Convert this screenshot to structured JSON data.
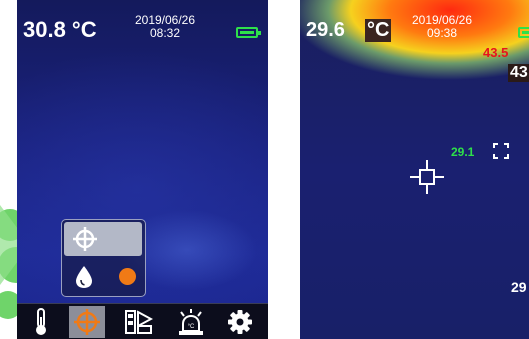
{
  "colors": {
    "accent_orange": "#f07a16",
    "battery_green": "#2ee04a",
    "hot_red": "#e8141c",
    "spot_green": "#2ee04a"
  },
  "left_screen": {
    "center_temp": "30.8 °C",
    "date": "2019/06/26",
    "time": "08:32",
    "battery_icon": "battery-full-icon",
    "mode_menu": {
      "selected_icon": "crosshair-icon",
      "second_icon": "water-drop-icon",
      "color_dot": "#f07a16"
    },
    "toolbar": [
      {
        "icon": "thermometer-icon"
      },
      {
        "icon": "crosshair-icon",
        "active": true
      },
      {
        "icon": "palette-icon"
      },
      {
        "icon": "alarm-icon"
      },
      {
        "icon": "gear-icon"
      }
    ]
  },
  "right_screen": {
    "center_temp": "29.6",
    "unit": "°C",
    "date": "2019/06/26",
    "time": "09:38",
    "max_value": "43.5",
    "max_value_chip": "43",
    "spot_value": "29.1",
    "min_value": "29",
    "battery_icon": "battery-full-icon"
  }
}
